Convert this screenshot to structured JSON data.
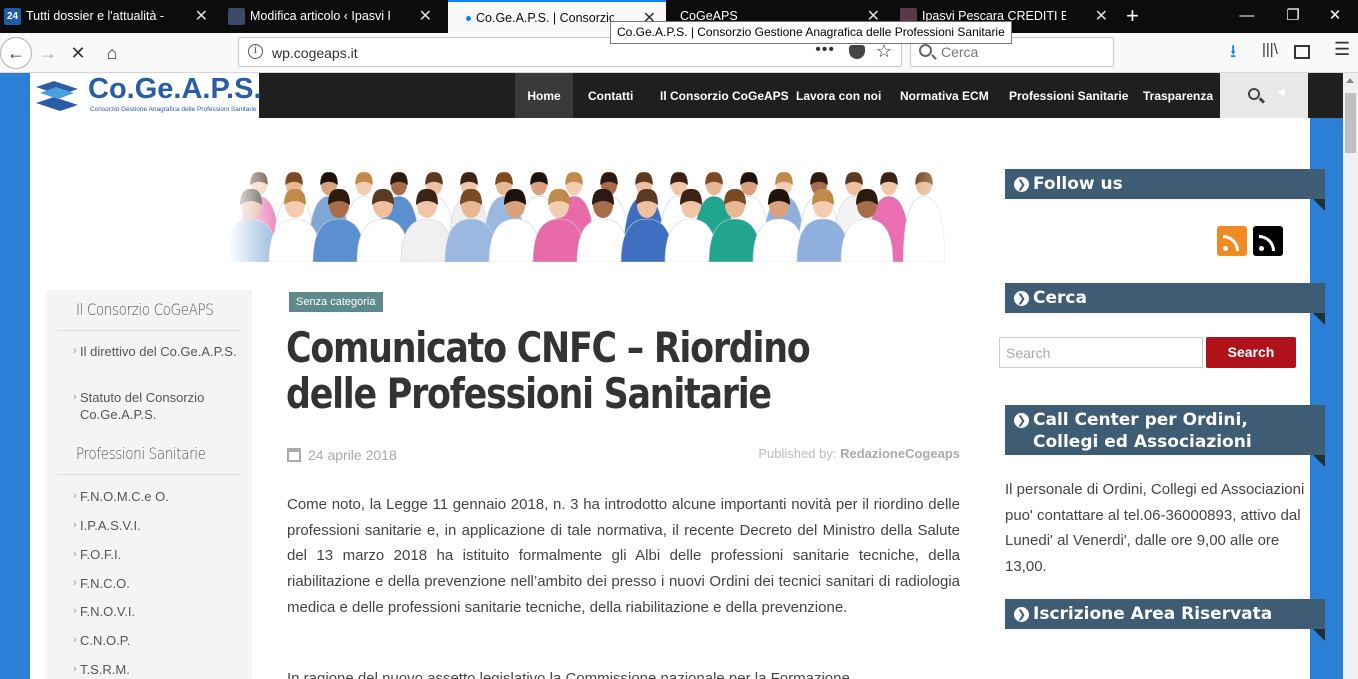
{
  "browser": {
    "tabs": [
      {
        "title": "Tutti dossier e l'attualità - Nurse",
        "favicon": "24-icon",
        "active": false
      },
      {
        "title": "Modifica articolo ‹ Ipasvi Pescara",
        "favicon": "site-icon",
        "active": false
      },
      {
        "title": "Co.Ge.A.P.S. | Consorzio Gestione",
        "favicon": "loading-dot",
        "active": true
      },
      {
        "title": "CoGeAPS",
        "favicon": "",
        "active": false
      },
      {
        "title": "Ipasvi Pescara CREDITI ECM: CO",
        "favicon": "site-icon",
        "active": false
      }
    ],
    "tooltip": "Co.Ge.A.P.S. | Consorzio Gestione Anagrafica delle Professioni Sanitarie",
    "url": "wp.cogeaps.it",
    "search_placeholder": "Cerca"
  },
  "site": {
    "logo_name": "Co.Ge.A.P.S.",
    "logo_sub": "Consorzio Gestione Anagrafica delle Professioni Sanitarie",
    "menu": [
      "Home",
      "Contatti",
      "Il Consorzio CoGeAPS",
      "Lavora con noi",
      "Normativa ECM",
      "Professioni Sanitarie",
      "Trasparenza"
    ]
  },
  "sidebar": {
    "heading1": "Il Consorzio CoGeAPS",
    "items1": [
      "Il direttivo del Co.Ge.A.P.S.",
      "Statuto del Consorzio Co.Ge.A.P.S."
    ],
    "heading2": "Professioni Sanitarie",
    "items2": [
      "F.N.O.M.C.e O.",
      "I.P.A.S.V.I.",
      "F.O.F.I.",
      "F.N.C.O.",
      "F.N.O.V.I.",
      "C.N.O.P.",
      "T.S.R.M."
    ]
  },
  "article": {
    "category": "Senza categoria",
    "title": "Comunicato CNFC – Riordino delle Professioni Sanitarie",
    "date": "24 aprile 2018",
    "published_label": "Published by:",
    "author": "RedazioneCogeaps",
    "paragraph1": "Come noto, la Legge 11 gennaio 2018, n. 3 ha introdotto alcune importanti novità per il riordino delle professioni sanitarie e, in applicazione di tale normativa, il recente Decreto del Ministro della Salute del 13 marzo 2018 ha istituito formalmente gli Albi delle professioni sanitarie tecniche, della riabilitazione e della prevenzione nell’ambito dei presso i nuovi Ordini dei tecnici sanitari di radiologia medica e delle professioni sanitarie tecniche, della riabilitazione e della prevenzione.",
    "paragraph2": "In ragione del nuovo assetto legislativo la Commissione nazionale per la Formazione"
  },
  "widgets": {
    "follow": "Follow us",
    "cerca": "Cerca",
    "search_placeholder": "Search",
    "search_button": "Search",
    "callcenter": "Call Center per Ordini, Collegi ed Associazioni",
    "callcenter_text": "Il personale di Ordini, Collegi ed Associazioni puo' contattare al tel.06-36000893, attivo dal Lunedi' al Venerdi', dalle ore 9,00 alle ore 13,00.",
    "iscrizione": "Iscrizione Area Riservata"
  }
}
